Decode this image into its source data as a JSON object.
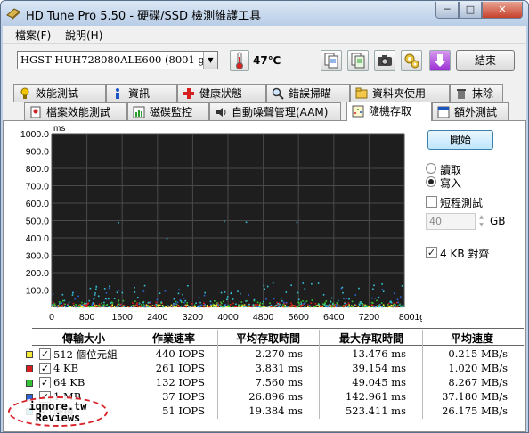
{
  "window": {
    "title": "HD Tune Pro 5.50 - 硬碟/SSD 檢測維護工具",
    "min": "─",
    "max": "□",
    "close": "✕"
  },
  "menu": [
    "檔案(F)",
    "說明(H)"
  ],
  "toolbar": {
    "drive": "HGST HUH728080ALE600 (8001 gB)",
    "temperature": "47℃",
    "exit": "結束",
    "icons": [
      "copy-info-icon",
      "copy-all-icon",
      "screenshot-icon",
      "options-icon",
      "save-icon"
    ]
  },
  "tabs": {
    "row1": [
      {
        "label": "效能測試",
        "icon": "benchmark-icon"
      },
      {
        "label": "資訊",
        "icon": "info-icon"
      },
      {
        "label": "健康狀態",
        "icon": "health-icon"
      },
      {
        "label": "錯誤掃瞄",
        "icon": "error-scan-icon"
      },
      {
        "label": "資料夾使用",
        "icon": "folder-usage-icon"
      },
      {
        "label": "抹除",
        "icon": "erase-icon"
      }
    ],
    "row2": [
      {
        "label": "檔案效能測試",
        "icon": "file-benchmark-icon"
      },
      {
        "label": "磁碟監控",
        "icon": "disk-monitor-icon"
      },
      {
        "label": "自動噪聲管理(AAM)",
        "icon": "aam-icon"
      },
      {
        "label": "隨機存取",
        "icon": "random-access-icon",
        "active": true
      },
      {
        "label": "額外測試",
        "icon": "extra-tests-icon"
      }
    ]
  },
  "controls": {
    "start": "開始",
    "read": "讀取",
    "write": "寫入",
    "mode": "write",
    "short_stroke": "短程測試",
    "short_stroke_checked": false,
    "gb_value": "40",
    "gb_unit": "GB",
    "align": "4 KB 對齊",
    "align_checked": true
  },
  "chart_data": {
    "type": "scatter",
    "yunit": "ms",
    "ylim": [
      0,
      1000
    ],
    "xlim": [
      0,
      8001
    ],
    "xunit": "gB",
    "yticks": [
      "1000.0",
      "900.0",
      "800.0",
      "700.0",
      "600.0",
      "500.0",
      "400.0",
      "300.0",
      "200.0",
      "100.0"
    ],
    "xticks": [
      "0",
      "800",
      "1600",
      "2400",
      "3200",
      "4000",
      "4800",
      "5600",
      "6400",
      "7200",
      "8001gB"
    ],
    "background": "#1e1e1e",
    "grid": true,
    "series": [
      {
        "name": "512 個位元組",
        "color": "#f5e93a"
      },
      {
        "name": "4 KB",
        "color": "#d81e1e"
      },
      {
        "name": "64 KB",
        "color": "#36c236"
      },
      {
        "name": "1 MB",
        "color": "#2e66d8"
      },
      {
        "name": "隨機",
        "color": "#35c4d8"
      }
    ],
    "outliers": [
      [
        1500,
        487
      ],
      [
        3900,
        494
      ],
      [
        5550,
        489
      ],
      [
        4400,
        490
      ],
      [
        2600,
        395
      ]
    ]
  },
  "table": {
    "headers": [
      "傳輸大小",
      "作業速率",
      "平均存取時間",
      "最大存取時間",
      "平均速度"
    ],
    "rows": [
      {
        "size": "512 個位元組",
        "color": "#f5e93a",
        "ops": "440 IOPS",
        "avg": "2.270 ms",
        "max": "13.476 ms",
        "speed": "0.215 MB/s"
      },
      {
        "size": "4 KB",
        "color": "#d81e1e",
        "ops": "261 IOPS",
        "avg": "3.831 ms",
        "max": "39.154 ms",
        "speed": "1.020 MB/s"
      },
      {
        "size": "64 KB",
        "color": "#36c236",
        "ops": "132 IOPS",
        "avg": "7.560 ms",
        "max": "49.045 ms",
        "speed": "8.267 MB/s"
      },
      {
        "size": "1 MB",
        "color": "#2e66d8",
        "ops": "37 IOPS",
        "avg": "26.896 ms",
        "max": "142.961 ms",
        "speed": "37.180 MB/s"
      },
      {
        "size": "隨機",
        "color": "#35c4d8",
        "ops": "51 IOPS",
        "avg": "19.384 ms",
        "max": "523.411 ms",
        "speed": "26.175 MB/s"
      }
    ]
  },
  "watermark": {
    "line1": "iqmore.tw",
    "line2": "Reviews"
  }
}
